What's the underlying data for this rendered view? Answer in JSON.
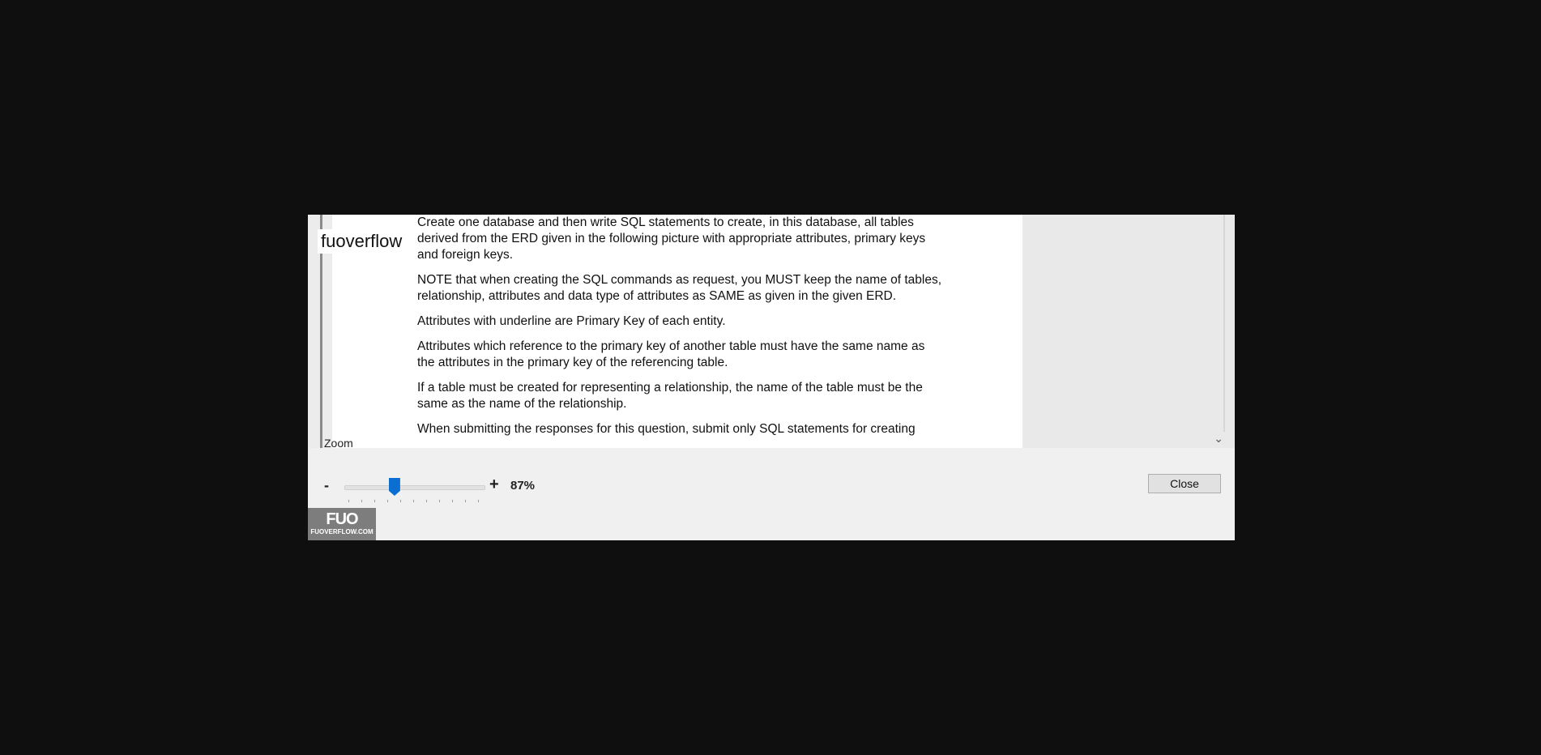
{
  "document": {
    "paragraphs": [
      "Create one database and then write SQL statements to create, in this database, all tables derived from the ERD given in the following picture with appropriate attributes, primary keys and foreign keys.",
      "NOTE that when creating the SQL commands as request, you MUST keep the name of tables, relationship, attributes and data type of attributes as SAME as given in the given ERD.",
      "Attributes with underline are Primary Key of each entity.",
      "Attributes which reference to the primary key of another table must have the same name as the attributes in the primary key of the referencing table.",
      "If a table must be created for representing a relationship, the name of the table must be the same as the name of the relationship.",
      "When submitting the responses for this question, submit only SQL statements for creating"
    ]
  },
  "watermark": {
    "label": "fuoverflow"
  },
  "zoom": {
    "label": "Zoom",
    "minus": "-",
    "plus": "+",
    "value_text": "87%",
    "slider_fraction": 0.36
  },
  "buttons": {
    "close": "Close"
  },
  "logo": {
    "mark": "FUO",
    "site": "FUOVERFLOW.COM"
  },
  "icons": {
    "scroll_down": "chevron-down-icon"
  },
  "colors": {
    "accent": "#0a6fd1",
    "background": "#0f0f0f",
    "dialog": "#f0f0f0"
  }
}
